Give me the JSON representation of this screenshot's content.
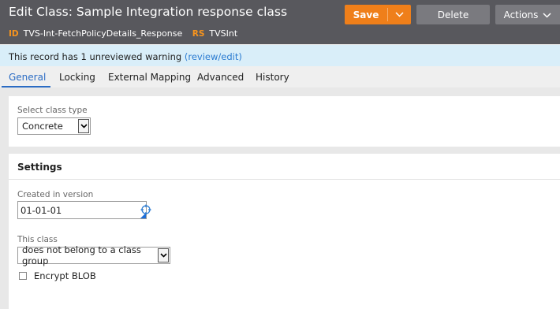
{
  "header": {
    "title": "Edit Class: Sample Integration response class",
    "id_tag": "ID",
    "id_value": "TVS-Int-FetchPolicyDetails_Response",
    "rs_tag": "RS",
    "rs_value": "TVSInt",
    "save_label": "Save",
    "delete_label": "Delete",
    "actions_label": "Actions",
    "accent_color": "#ef7f1a"
  },
  "warning": {
    "text": "This record has 1 unreviewed warning ",
    "link": "(review/edit)"
  },
  "tabs": [
    {
      "label": "General",
      "active": true
    },
    {
      "label": "Locking"
    },
    {
      "label": "External Mapping"
    },
    {
      "label": "Advanced"
    },
    {
      "label": "History"
    }
  ],
  "class_type": {
    "label": "Select class type",
    "value": "Concrete"
  },
  "settings": {
    "title": "Settings",
    "created_label": "Created in version",
    "created_value": "01-01-01",
    "class_label": "This class",
    "class_value": "does not belong to a class group",
    "encrypt_label": "Encrypt BLOB",
    "encrypt_checked": false
  }
}
